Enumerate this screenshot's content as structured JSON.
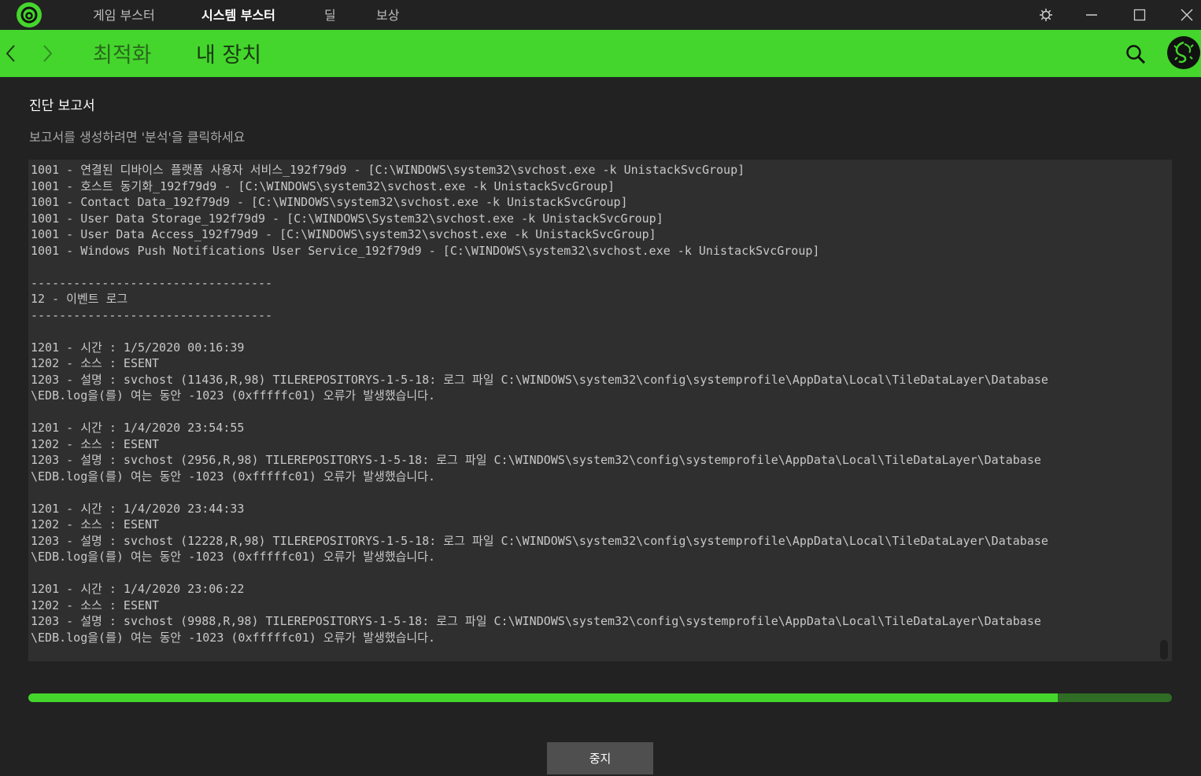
{
  "top_tabs": [
    {
      "label": "게임 부스터",
      "active": false
    },
    {
      "label": "시스템 부스터",
      "active": true
    },
    {
      "label": "딜",
      "active": false
    },
    {
      "label": "보상",
      "active": false
    }
  ],
  "nav": {
    "tabs": [
      {
        "label": "최적화",
        "active": false
      },
      {
        "label": "내 장치",
        "active": true
      }
    ]
  },
  "content": {
    "title": "진단 보고서",
    "subtitle": "보고서를 생성하려면 '분석'을 클릭하세요",
    "log_lines": [
      "1001 - 연결된 디바이스 플랫폼 사용자 서비스_192f79d9 - [C:\\WINDOWS\\system32\\svchost.exe -k UnistackSvcGroup]",
      "1001 - 호스트 동기화_192f79d9 - [C:\\WINDOWS\\system32\\svchost.exe -k UnistackSvcGroup]",
      "1001 - Contact Data_192f79d9 - [C:\\WINDOWS\\system32\\svchost.exe -k UnistackSvcGroup]",
      "1001 - User Data Storage_192f79d9 - [C:\\WINDOWS\\System32\\svchost.exe -k UnistackSvcGroup]",
      "1001 - User Data Access_192f79d9 - [C:\\WINDOWS\\system32\\svchost.exe -k UnistackSvcGroup]",
      "1001 - Windows Push Notifications User Service_192f79d9 - [C:\\WINDOWS\\system32\\svchost.exe -k UnistackSvcGroup]",
      "",
      "----------------------------------",
      "12 - 이벤트 로그",
      "----------------------------------",
      "",
      "1201 - 시간 : 1/5/2020 00:16:39",
      "1202 - 소스 : ESENT",
      "1203 - 설명 : svchost (11436,R,98) TILEREPOSITORYS-1-5-18: 로그 파일 C:\\WINDOWS\\system32\\config\\systemprofile\\AppData\\Local\\TileDataLayer\\Database",
      "\\EDB.log을(를) 여는 동안 -1023 (0xfffffc01) 오류가 발생했습니다.",
      "",
      "1201 - 시간 : 1/4/2020 23:54:55",
      "1202 - 소스 : ESENT",
      "1203 - 설명 : svchost (2956,R,98) TILEREPOSITORYS-1-5-18: 로그 파일 C:\\WINDOWS\\system32\\config\\systemprofile\\AppData\\Local\\TileDataLayer\\Database",
      "\\EDB.log을(를) 여는 동안 -1023 (0xfffffc01) 오류가 발생했습니다.",
      "",
      "1201 - 시간 : 1/4/2020 23:44:33",
      "1202 - 소스 : ESENT",
      "1203 - 설명 : svchost (12228,R,98) TILEREPOSITORYS-1-5-18: 로그 파일 C:\\WINDOWS\\system32\\config\\systemprofile\\AppData\\Local\\TileDataLayer\\Database",
      "\\EDB.log을(를) 여는 동안 -1023 (0xfffffc01) 오류가 발생했습니다.",
      "",
      "1201 - 시간 : 1/4/2020 23:06:22",
      "1202 - 소스 : ESENT",
      "1203 - 설명 : svchost (9988,R,98) TILEREPOSITORYS-1-5-18: 로그 파일 C:\\WINDOWS\\system32\\config\\systemprofile\\AppData\\Local\\TileDataLayer\\Database",
      "\\EDB.log을(를) 여는 동안 -1023 (0xfffffc01) 오류가 발생했습니다."
    ]
  },
  "progress": {
    "fraction": 0.9
  },
  "buttons": {
    "stop_label": "중지"
  },
  "icons": {
    "logo": "razer-cortex-logo-icon",
    "settings": "gear-icon",
    "minimize": "minimize-icon",
    "maximize": "maximize-icon",
    "close": "close-icon",
    "back": "chevron-left-icon",
    "forward": "chevron-right-icon",
    "search": "search-icon",
    "avatar": "razer-snake-avatar-icon"
  },
  "colors": {
    "accent": "#44d62c",
    "background": "#222222",
    "log_background": "#2f2f2f",
    "progress_track": "#2f6d24",
    "button": "#4f4f4f"
  }
}
